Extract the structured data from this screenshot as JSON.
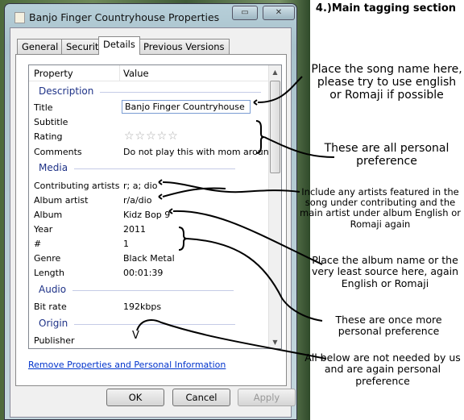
{
  "window": {
    "title": "Banjo Finger Countryhouse Properties",
    "restore_label": "▭",
    "close_label": "✕"
  },
  "tabs": [
    "General",
    "Security",
    "Details",
    "Previous Versions"
  ],
  "list": {
    "col_property": "Property",
    "col_value": "Value",
    "groups": {
      "description": "Description",
      "media": "Media",
      "audio": "Audio",
      "origin": "Origin"
    },
    "rows": {
      "title": {
        "k": "Title",
        "v": "Banjo Finger Countryhouse"
      },
      "subtitle": {
        "k": "Subtitle",
        "v": ""
      },
      "rating": {
        "k": "Rating",
        "v": "☆☆☆☆☆"
      },
      "comments": {
        "k": "Comments",
        "v": "Do not play this with mom around"
      },
      "contrib": {
        "k": "Contributing artists",
        "v": "r; a; dio"
      },
      "albumartist": {
        "k": "Album artist",
        "v": "r/a/dio"
      },
      "album": {
        "k": "Album",
        "v": "Kidz Bop 9"
      },
      "year": {
        "k": "Year",
        "v": "2011"
      },
      "num": {
        "k": "#",
        "v": "1"
      },
      "genre": {
        "k": "Genre",
        "v": "Black Metal"
      },
      "length": {
        "k": "Length",
        "v": "00:01:39"
      },
      "bitrate": {
        "k": "Bit rate",
        "v": "192kbps"
      },
      "publisher": {
        "k": "Publisher",
        "v": ""
      }
    }
  },
  "remove_link": "Remove Properties and Personal Information",
  "buttons": {
    "ok": "OK",
    "cancel": "Cancel",
    "apply": "Apply"
  },
  "notes": {
    "heading": "4.)Main tagging section",
    "song": "Place the song name here, please try to use english or Romaji if possible",
    "personal": "These are all personal preference",
    "artists": "Include any artists featured in the song under contributing and the main artist under album English or Romaji again",
    "album": "Place the album name or the very least source here, again English or Romaji",
    "once": "These are once more personal preference",
    "below": "All below are not needed by us and are again personal preference",
    "v": "V"
  }
}
